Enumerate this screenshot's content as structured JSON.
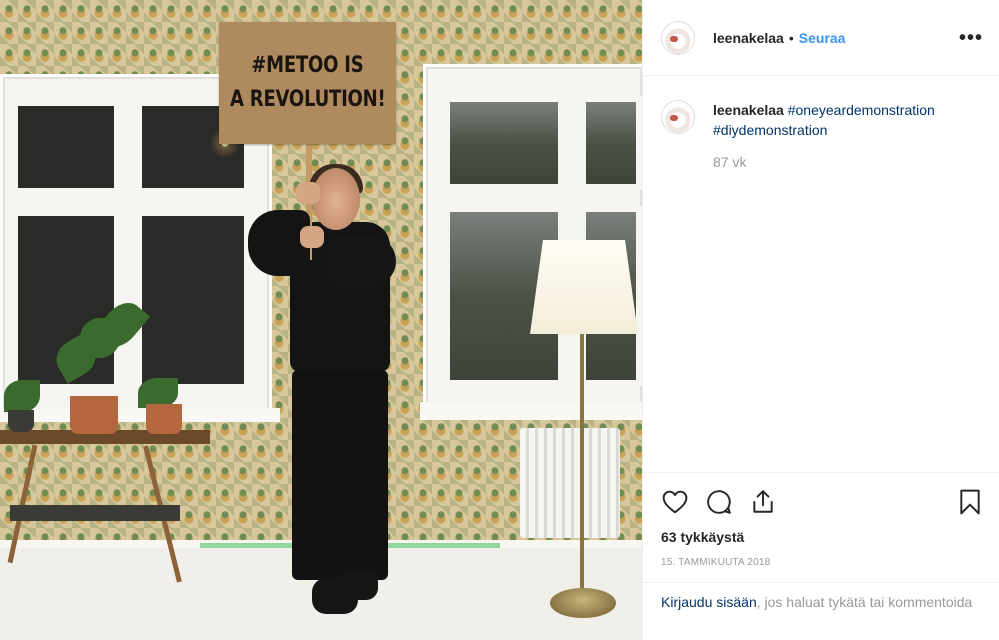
{
  "photo": {
    "sign_line1": "#METOO IS",
    "sign_line2": "A REVOLUTION!"
  },
  "header": {
    "username": "leenakelaa",
    "separator": "•",
    "follow_label": "Seuraa",
    "more_label": "•••"
  },
  "caption": {
    "username": "leenakelaa",
    "hashtag1": "#oneyeardemonstration",
    "hashtag2": "#diydemonstration",
    "time_ago": "87 vk"
  },
  "actions": {
    "likes": "63 tykkäystä",
    "date": "15. TAMMIKUUTA 2018"
  },
  "login": {
    "link_label": "Kirjaudu sisään",
    "rest_text": ", jos haluat tykätä tai kommentoida"
  },
  "icons": {
    "like": "heart-icon",
    "comment": "comment-icon",
    "share": "share-icon",
    "save": "bookmark-icon",
    "more": "more-options-icon"
  },
  "colors": {
    "link_blue": "#3897f0",
    "hashtag_navy": "#003569",
    "muted_gray": "#999999",
    "text": "#262626",
    "divider": "#efefef"
  }
}
